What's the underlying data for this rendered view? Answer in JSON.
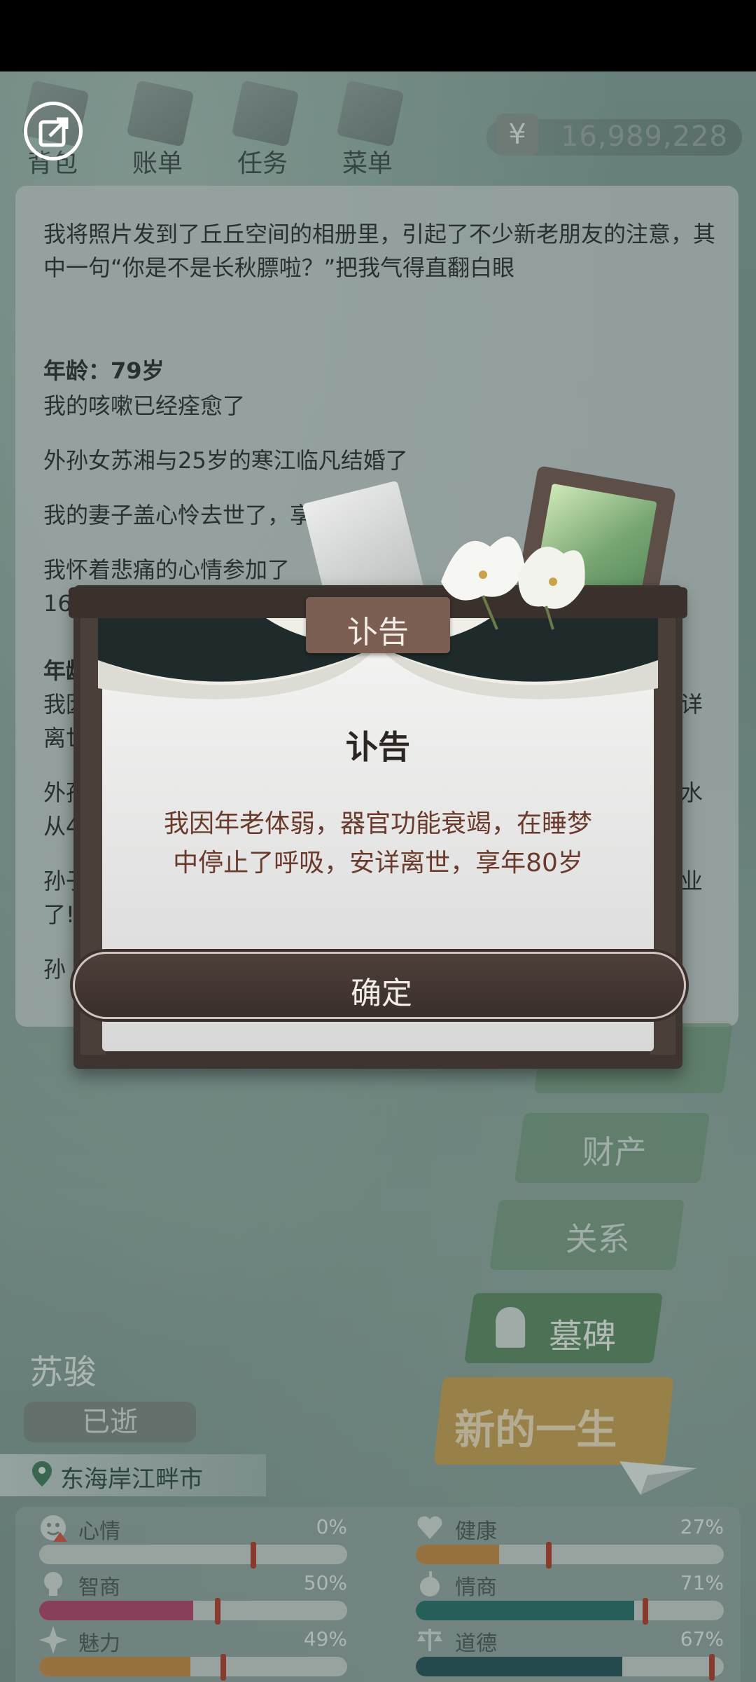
{
  "top_nav": {
    "items": [
      {
        "label": "背包"
      },
      {
        "label": "账单"
      },
      {
        "label": "任务"
      },
      {
        "label": "菜单"
      }
    ],
    "money": {
      "symbol": "¥",
      "value": "16,989,228"
    }
  },
  "log": {
    "lines": [
      {
        "text": "我将照片发到了丘丘空间的相册里，引起了不少新老朋友的注意，其中一句“你是不是长秋膘啦？”把我气得直翻白眼"
      },
      {
        "text": "年龄：79岁"
      },
      {
        "text": "我的咳嗽已经痊愈了"
      },
      {
        "text": "外孙女苏湘与25岁的寒江临凡结婚了"
      },
      {
        "text": "我的妻子盖心怜去世了，享年79岁"
      },
      {
        "text": "我怀着悲痛的心情参加了"
      },
      {
        "text": "16"
      },
      {
        "text": "年龄"
      },
      {
        "text": "我因"
      },
      {
        "text": "详"
      },
      {
        "text": "离世"
      },
      {
        "text": "外孙"
      },
      {
        "text": "水"
      },
      {
        "text": "从4"
      },
      {
        "text": "孙子"
      },
      {
        "text": "业"
      },
      {
        "text": "了!"
      },
      {
        "text": "孙"
      }
    ]
  },
  "side_buttons": {
    "property": "财产",
    "relations": "关系",
    "tombstone": "墓碑",
    "new_life": "新的一生"
  },
  "character": {
    "name": "苏骏",
    "status": "已逝",
    "location": "东海岸江畔市"
  },
  "stats": [
    {
      "name": "心情",
      "pct": "0%",
      "value": 0,
      "color": "#c9d1cf",
      "marker": 0.7
    },
    {
      "name": "健康",
      "pct": "27%",
      "value": 27,
      "color": "#c98a45",
      "marker": 0.43
    },
    {
      "name": "智商",
      "pct": "50%",
      "value": 50,
      "color": "#b3416e",
      "marker": 0.58
    },
    {
      "name": "情商",
      "pct": "71%",
      "value": 71,
      "color": "#26706a",
      "marker": 0.75
    },
    {
      "name": "魅力",
      "pct": "49%",
      "value": 49,
      "color": "#c98a45",
      "marker": 0.6
    },
    {
      "name": "道德",
      "pct": "67%",
      "value": 67,
      "color": "#23525a",
      "marker": 0.97
    }
  ],
  "modal": {
    "tag": "讣告",
    "title": "讣告",
    "body_line1": "我因年老体弱，器官功能衰竭，在睡梦",
    "body_line2": "中停止了呼吸，安详离世，享年80岁",
    "ok_label": "确定"
  }
}
